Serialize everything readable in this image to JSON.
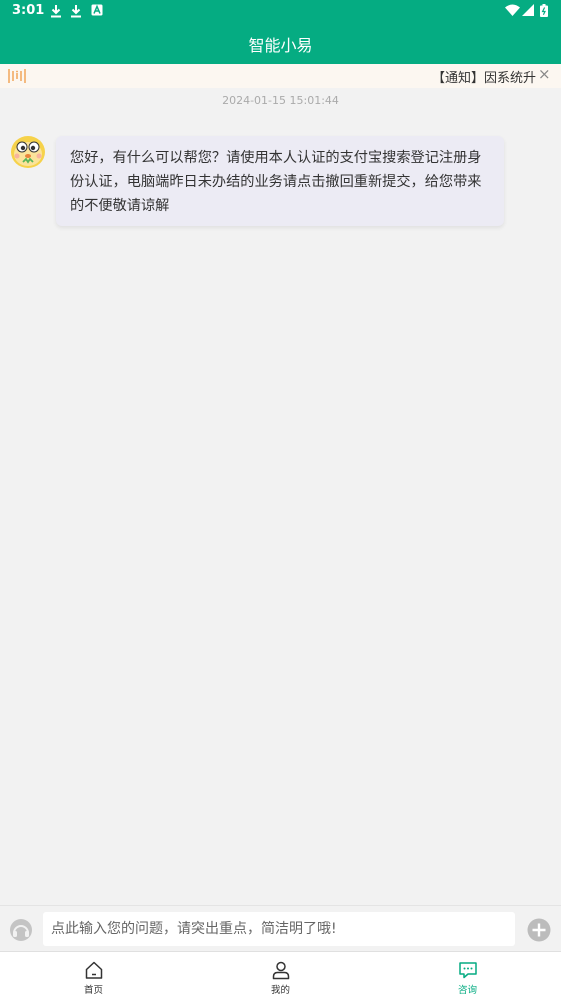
{
  "status_bar": {
    "time": "3:01"
  },
  "header": {
    "title": "智能小易"
  },
  "notice": {
    "text": "【通知】因系统升级维护"
  },
  "chat": {
    "timestamp": "2024-01-15 15:01:44",
    "messages": [
      {
        "text": "您好，有什么可以帮您？请使用本人认证的支付宝搜索登记注册身份认证，电脑端昨日未办结的业务请点击撤回重新提交，给您带来的不便敬请谅解"
      }
    ]
  },
  "input": {
    "placeholder": "点此输入您的问题，请突出重点，简洁明了哦!"
  },
  "tabs": [
    {
      "label": "首页",
      "icon": "home-icon"
    },
    {
      "label": "我的",
      "icon": "user-icon"
    },
    {
      "label": "咨询",
      "icon": "chat-icon"
    }
  ],
  "colors": {
    "brand": "#05ac82",
    "notice_icon": "#f0a050"
  }
}
